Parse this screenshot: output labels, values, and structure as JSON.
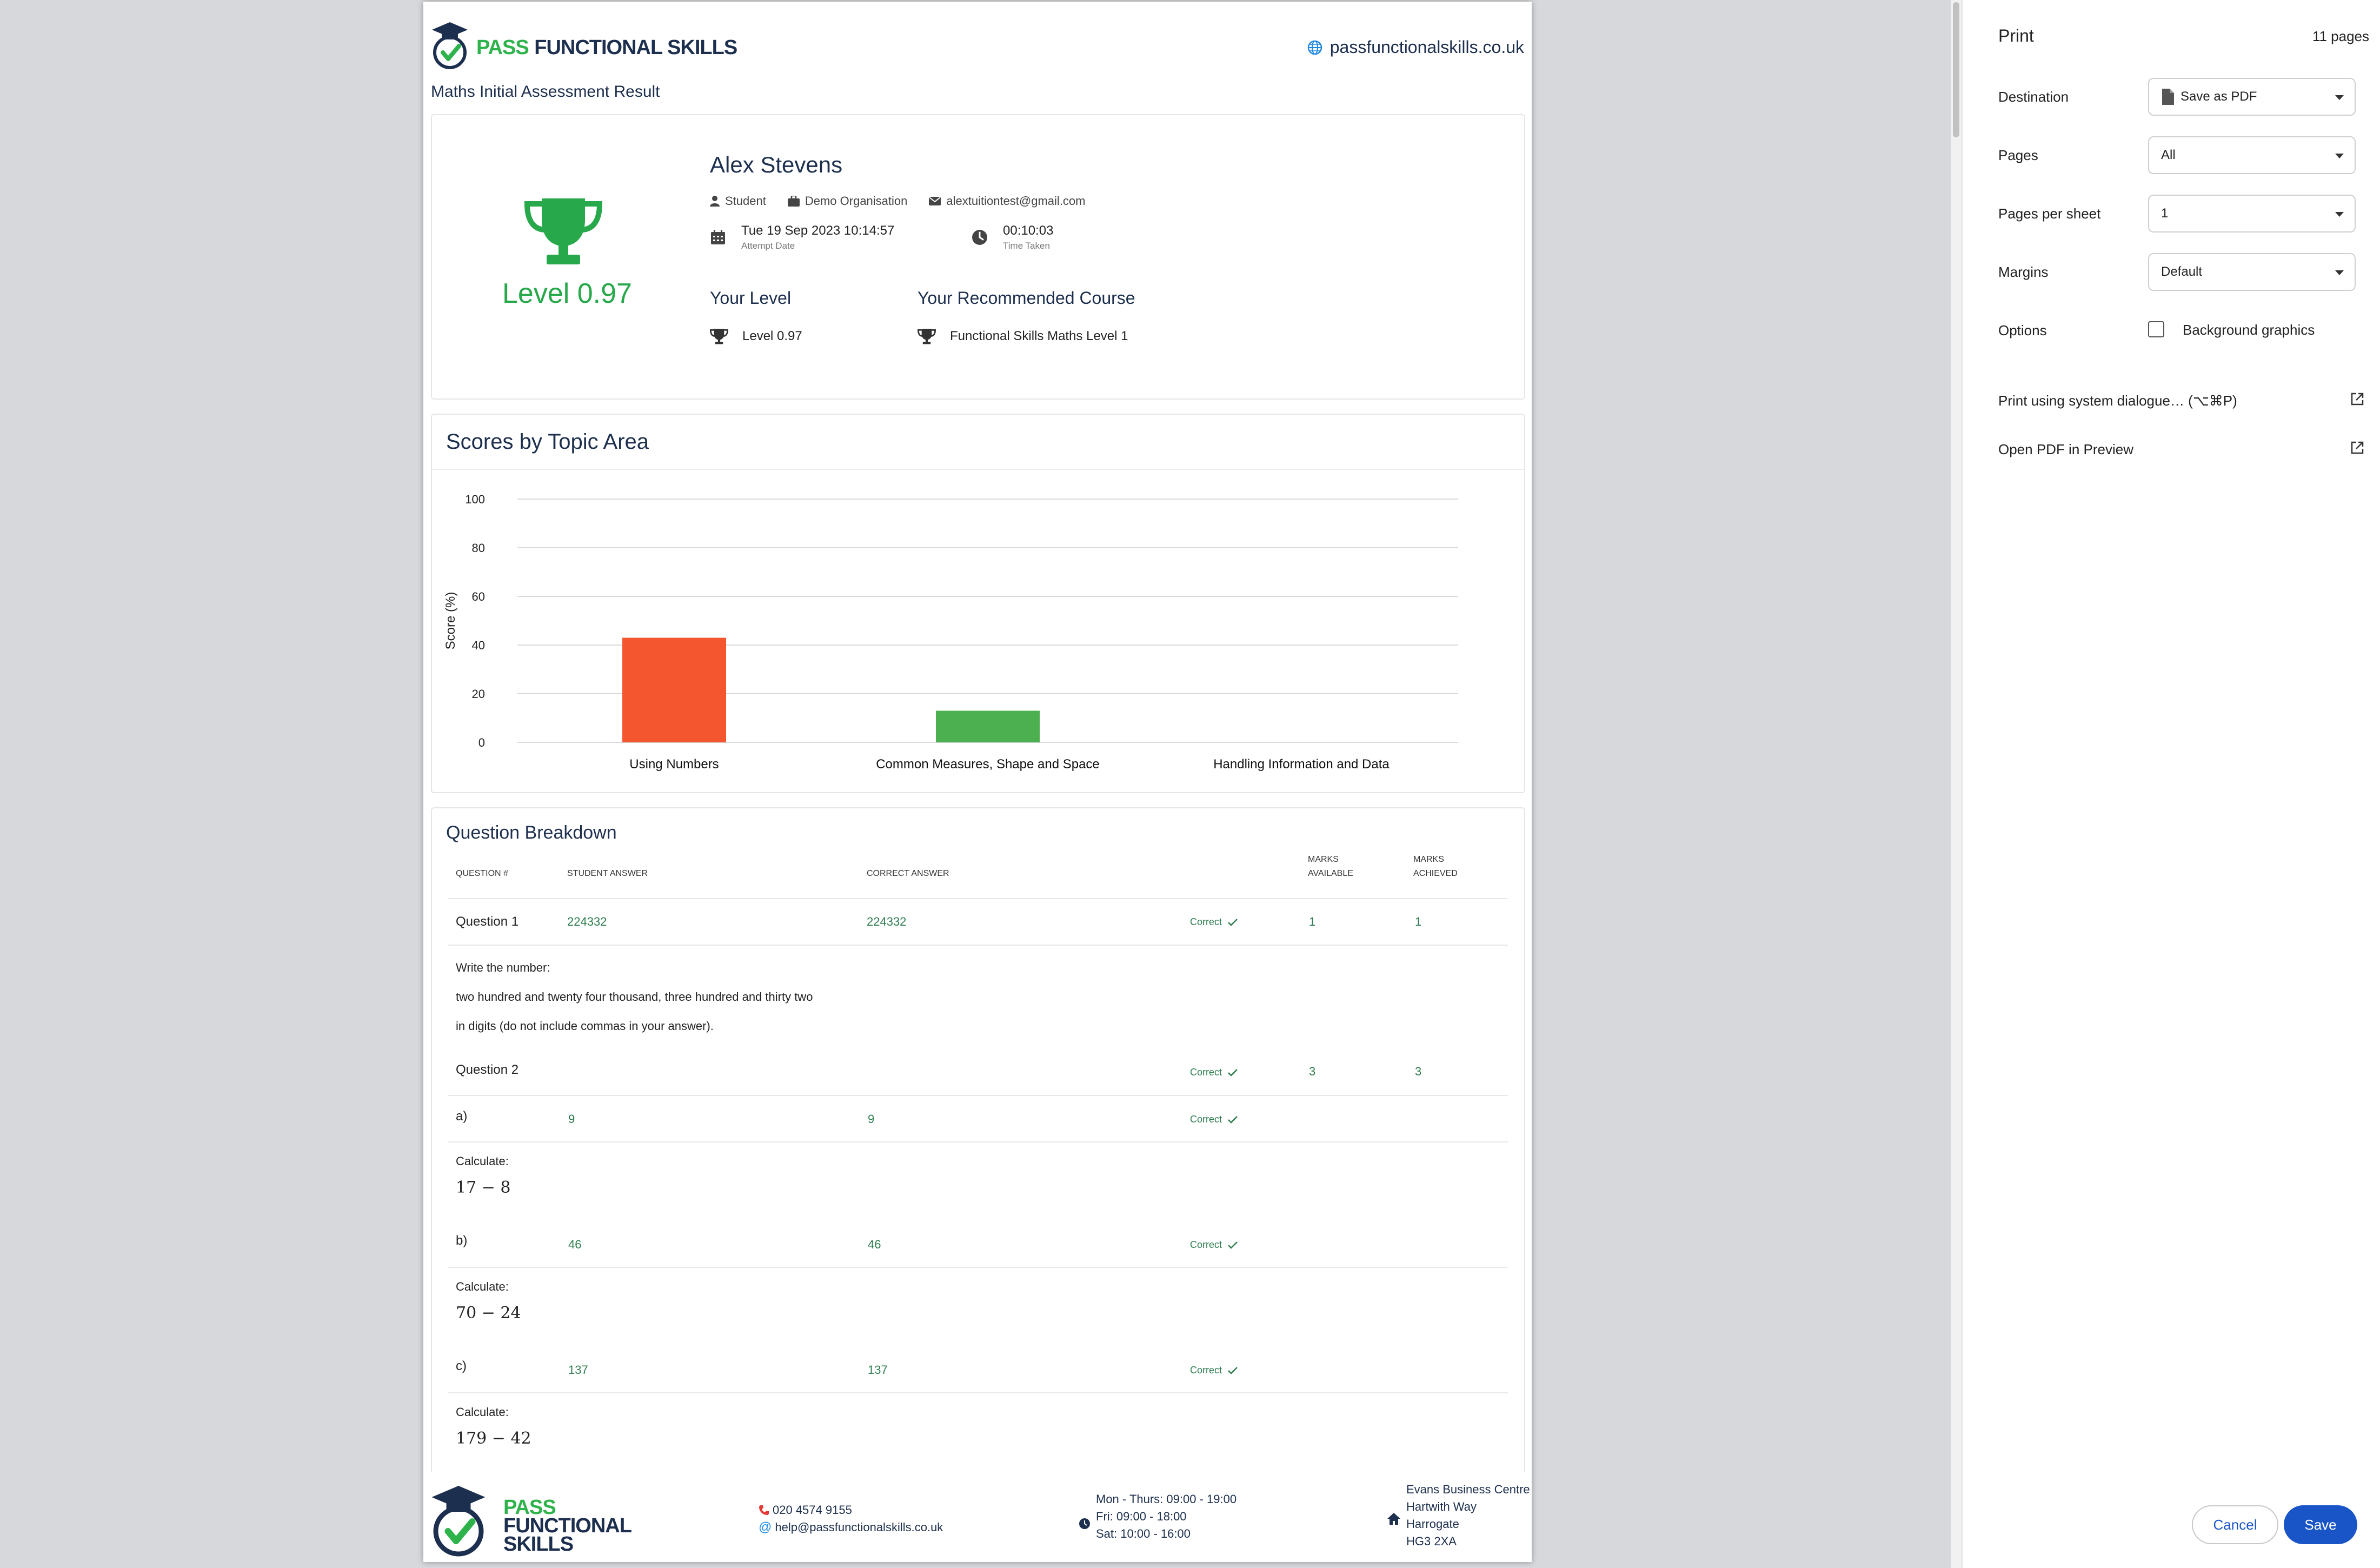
{
  "header": {
    "brand_pass": "PASS",
    "brand_rest": "FUNCTIONAL SKILLS",
    "site": "passfunctionalskills.co.uk",
    "report_title": "Maths Initial Assessment Result"
  },
  "profile": {
    "big_level": "Level 0.97",
    "name": "Alex Stevens",
    "role": "Student",
    "organisation": "Demo Organisation",
    "email": "alextuitiontest@gmail.com",
    "attempt_date": "Tue 19 Sep 2023 10:14:57",
    "attempt_date_label": "Attempt Date",
    "time_taken": "00:10:03",
    "time_taken_label": "Time Taken",
    "your_level_heading": "Your Level",
    "your_level_value": "Level 0.97",
    "course_heading": "Your Recommended Course",
    "course_value": "Functional Skills Maths Level 1"
  },
  "chart_data": {
    "type": "bar",
    "title": "Scores by Topic Area",
    "ylabel": "Score (%)",
    "xlabel": "",
    "ylim": [
      0,
      100
    ],
    "yticks": [
      0,
      20,
      40,
      60,
      80,
      100
    ],
    "categories": [
      "Using Numbers",
      "Common Measures, Shape and Space",
      "Handling Information and Data"
    ],
    "values": [
      43,
      13,
      0
    ],
    "colors": [
      "#f4572f",
      "#4caf50",
      "#2196f3"
    ],
    "grid": true
  },
  "breakdown": {
    "title": "Question Breakdown",
    "columns": {
      "question": "QUESTION #",
      "student": "STUDENT ANSWER",
      "correct": "CORRECT ANSWER",
      "available_1": "MARKS",
      "available_2": "AVAILABLE",
      "achieved_1": "MARKS",
      "achieved_2": "ACHIEVED"
    },
    "status_correct": "Correct",
    "q1": {
      "label": "Question 1",
      "student": "224332",
      "correct": "224332",
      "available": "1",
      "achieved": "1",
      "text_1": "Write the number:",
      "text_2": "two hundred and twenty four thousand, three hundred and thirty two",
      "text_3": "in digits (do not include commas in your answer)."
    },
    "q2": {
      "label": "Question 2",
      "available": "3",
      "achieved": "3",
      "a_label": "a)",
      "a_student": "9",
      "a_correct": "9",
      "a_prompt": "Calculate:",
      "a_math": "17 − 8",
      "b_label": "b)",
      "b_student": "46",
      "b_correct": "46",
      "b_prompt": "Calculate:",
      "b_math": "70 − 24",
      "c_label": "c)",
      "c_student": "137",
      "c_correct": "137",
      "c_prompt": "Calculate:",
      "c_math": "179 − 42"
    }
  },
  "footer": {
    "brand_1": "PASS",
    "brand_2": "FUNCTIONAL",
    "brand_3": "SKILLS",
    "phone": "020 4574 9155",
    "email": "help@passfunctionalskills.co.uk",
    "hours_1": "Mon - Thurs: 09:00 - 19:00",
    "hours_2": "Fri: 09:00 - 18:00",
    "hours_3": "Sat: 10:00 - 16:00",
    "addr_1": "Evans Business Centre",
    "addr_2": "Hartwith Way",
    "addr_3": "Harrogate",
    "addr_4": "HG3 2XA"
  },
  "print_panel": {
    "title": "Print",
    "page_count": "11 pages",
    "destination_label": "Destination",
    "destination_value": "Save as PDF",
    "pages_label": "Pages",
    "pages_value": "All",
    "pps_label": "Pages per sheet",
    "pps_value": "1",
    "margins_label": "Margins",
    "margins_value": "Default",
    "options_label": "Options",
    "bg_graphics_label": "Background graphics",
    "system_dialog": "Print using system dialogue… (⌥⌘P)",
    "open_pdf": "Open PDF in Preview",
    "cancel": "Cancel",
    "save": "Save"
  }
}
